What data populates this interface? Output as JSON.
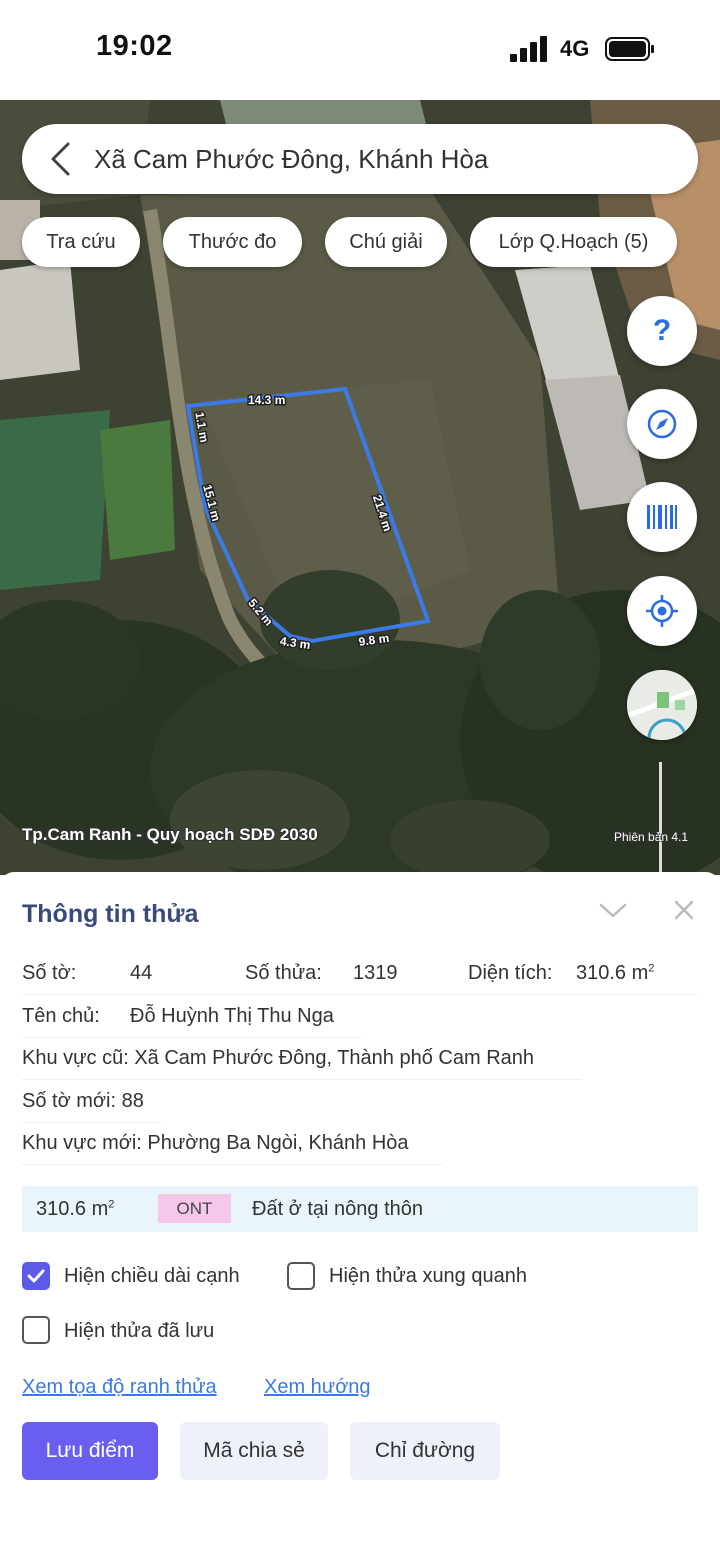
{
  "status_bar": {
    "time": "19:02",
    "network": "4G"
  },
  "search": {
    "text": "Xã Cam Phước Đông, Khánh Hòa"
  },
  "chips": [
    "Tra cứu",
    "Thước đo",
    "Chú giải",
    "Lớp Q.Hoạch (5)"
  ],
  "fabs": {
    "help": "?",
    "icons": [
      "help-icon",
      "compass-icon",
      "barcode-icon",
      "locate-icon",
      "map-layer-icon"
    ]
  },
  "map": {
    "edge_labels": [
      "14.3 m",
      "1.1 m",
      "15.1 m",
      "21.4 m",
      "5.2 m",
      "4.3 m",
      "9.8 m"
    ],
    "plan_label": "Tp.Cam Ranh - Quy hoạch SDĐ 2030",
    "version_label": "Phiên bản 4.1",
    "parcel_color": "#3a7be8"
  },
  "sheet": {
    "title": "Thông tin thửa",
    "so_to_label": "Số tờ:",
    "so_to_value": "44",
    "so_thua_label": "Số thửa:",
    "so_thua_value": "1319",
    "dien_tich_label": "Diện tích:",
    "dien_tich_value": "310.6 m",
    "dien_tich_sup": "2",
    "ten_chu": "Tên chủ:",
    "ten_chu_value": "Đỗ Huỳnh Thị Thu Nga",
    "khu_vuc_cu": "Khu vực cũ: Xã Cam Phước Đông, Thành phố Cam Ranh",
    "so_to_moi": "Số tờ mới: 88",
    "khu_vuc_moi": "Khu vực mới: Phường Ba Ngòi, Khánh Hòa",
    "land_area": "310.6 m",
    "land_area_sup": "2",
    "land_code": "ONT",
    "land_type": "Đất ở tại nông thôn",
    "check_edges": "Hiện chiều dài cạnh",
    "check_neighbors": "Hiện thửa xung quanh",
    "check_saved": "Hiện thửa đã lưu",
    "link_coords": "Xem tọa độ ranh thửa",
    "link_direction": "Xem hướng",
    "btn_save": "Lưu điểm",
    "btn_share": "Mã chia sẻ",
    "btn_directions": "Chỉ đường"
  },
  "colors": {
    "primary": "#6a5ef0",
    "link": "#3b7be0",
    "title": "#3a4a7a",
    "ont_badge": "#f5c8ea"
  }
}
